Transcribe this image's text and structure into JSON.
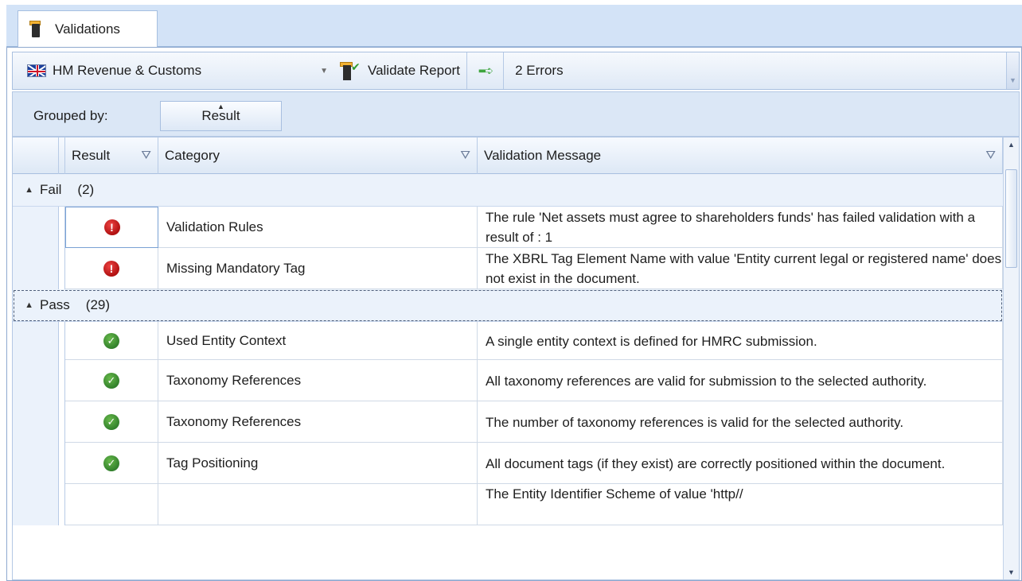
{
  "tab": {
    "label": "Validations"
  },
  "toolbar": {
    "authority": "HM Revenue & Customs",
    "validate_label": "Validate Report",
    "error_summary": "2 Errors"
  },
  "group_panel": {
    "label": "Grouped by:",
    "chip": "Result"
  },
  "grid": {
    "columns": [
      "Result",
      "Category",
      "Validation Message"
    ],
    "groups": [
      {
        "name": "Fail",
        "count": "(2)",
        "rows": [
          {
            "result": "error",
            "category": "Validation Rules",
            "message": "The rule 'Net assets must agree to shareholders funds' has failed validation with a result of : 1"
          },
          {
            "result": "error",
            "category": "Missing Mandatory Tag",
            "message": "The XBRL Tag Element Name with value 'Entity current legal or registered name' does not exist in the document."
          }
        ]
      },
      {
        "name": "Pass",
        "count": "(29)",
        "rows": [
          {
            "result": "ok",
            "category": "Used Entity Context",
            "message": "A single entity context is defined for HMRC submission."
          },
          {
            "result": "ok",
            "category": "Taxonomy References",
            "message": "All taxonomy references are valid for submission to the selected authority."
          },
          {
            "result": "ok",
            "category": "Taxonomy References",
            "message": "The number of taxonomy references is valid for the selected authority."
          },
          {
            "result": "ok",
            "category": "Tag Positioning",
            "message": "All document tags (if they exist) are correctly positioned within the document."
          },
          {
            "result": "ok",
            "category": "",
            "message": "The Entity Identifier Scheme of value 'http//"
          }
        ]
      }
    ]
  },
  "icons": {
    "tab": "validate-tool-icon",
    "flag": "uk-flag-icon",
    "validate": "validate-report-icon",
    "errors": "next-error-arrow-icon",
    "filter": "filter-funnel-icon",
    "error": "error-exclamation-icon",
    "ok": "checkmark-icon"
  },
  "colors": {
    "error": "#b01010",
    "ok": "#2f7d2a",
    "header_bg": "#d3e3f7"
  }
}
